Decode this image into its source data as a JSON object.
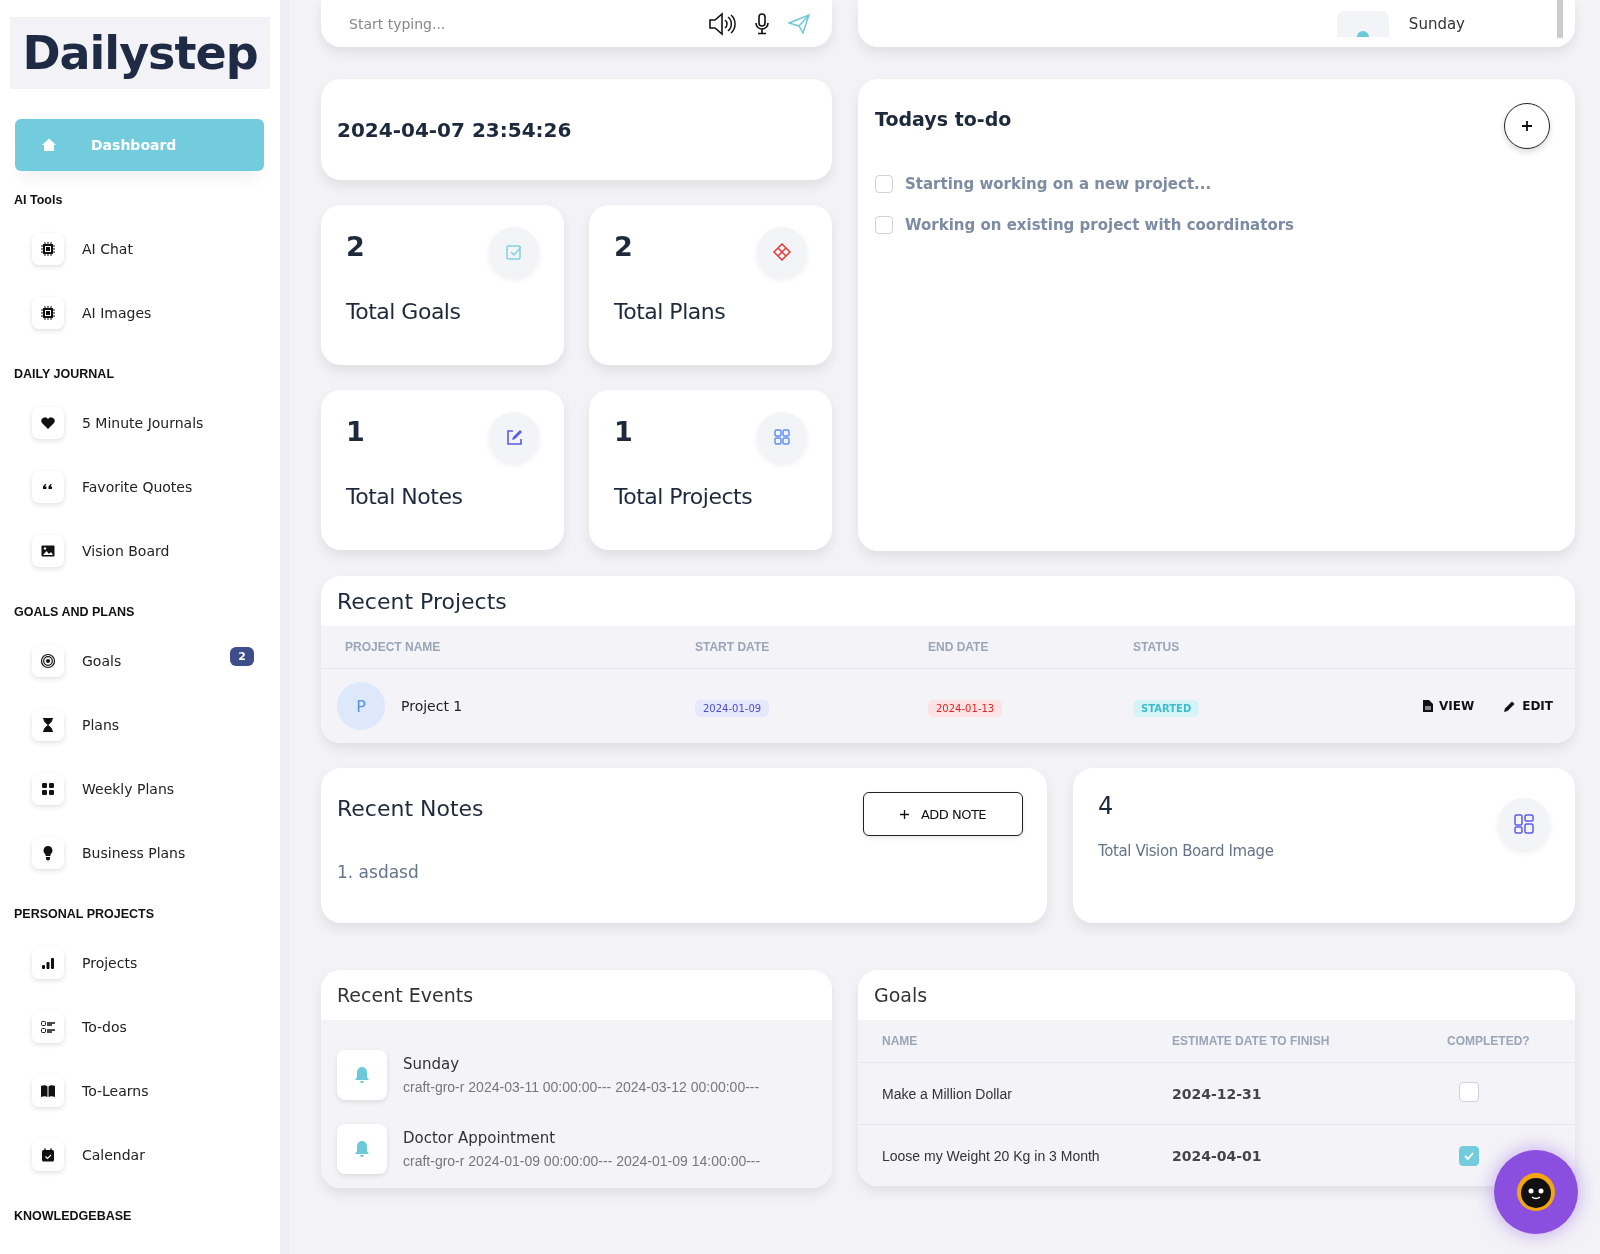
{
  "logo": {
    "text": "Dailystep"
  },
  "sidebar": {
    "dashboard": {
      "label": "Dashboard",
      "selected": true
    },
    "sections": [
      {
        "heading": "AI Tools",
        "items": [
          {
            "label": "AI Chat",
            "selected": false
          },
          {
            "label": "AI Images",
            "selected": false
          }
        ]
      },
      {
        "heading": "DAILY JOURNAL",
        "items": [
          {
            "label": "5 Minute Journals",
            "selected": false
          },
          {
            "label": "Favorite Quotes",
            "selected": false
          },
          {
            "label": "Vision Board",
            "selected": false
          }
        ]
      },
      {
        "heading": "GOALS AND PLANS",
        "items": [
          {
            "label": "Goals",
            "selected": false,
            "badge": "2"
          },
          {
            "label": "Plans",
            "selected": false
          },
          {
            "label": "Weekly Plans",
            "selected": false
          },
          {
            "label": "Business Plans",
            "selected": false
          }
        ]
      },
      {
        "heading": "PERSONAL PROJECTS",
        "items": [
          {
            "label": "Projects",
            "selected": false
          },
          {
            "label": "To-dos",
            "selected": false
          },
          {
            "label": "To-Learns",
            "selected": false
          },
          {
            "label": "Calendar",
            "selected": false
          }
        ]
      },
      {
        "heading": "KNOWLEDGEBASE"
      }
    ]
  },
  "chat": {
    "placeholder": "Start typing..."
  },
  "top_event": {
    "title": "Sunday"
  },
  "datetime": "2024-04-07 23:54:26",
  "stats": [
    {
      "value": "2",
      "label": "Total Goals"
    },
    {
      "value": "2",
      "label": "Total Plans"
    },
    {
      "value": "1",
      "label": "Total Notes"
    },
    {
      "value": "1",
      "label": "Total Projects"
    }
  ],
  "todo": {
    "title": "Todays to-do",
    "items": [
      {
        "text": "Starting working on a new project...",
        "checked": false
      },
      {
        "text": "Working on existing project with coordinators",
        "checked": false
      }
    ]
  },
  "recent_projects": {
    "title": "Recent Projects",
    "columns": [
      "PROJECT NAME",
      "START DATE",
      "END DATE",
      "STATUS"
    ],
    "rows": [
      {
        "avatar": "P",
        "name": "Project 1",
        "start_date": "2024-01-09",
        "end_date": "2024-01-13",
        "status": "STARTED",
        "actions": [
          "VIEW",
          "EDIT"
        ]
      }
    ]
  },
  "recent_notes": {
    "title": "Recent Notes",
    "button": "ADD NOTE",
    "items": [
      "1. asdasd"
    ]
  },
  "vision": {
    "value": "4",
    "label": "Total Vision Board Image"
  },
  "recent_events": {
    "title": "Recent Events",
    "items": [
      {
        "title": "Sunday",
        "detail": "craft-gro-r 2024-03-11 00:00:00--- 2024-03-12 00:00:00---"
      },
      {
        "title": "Doctor Appointment",
        "detail": "craft-gro-r 2024-01-09 00:00:00--- 2024-01-09 14:00:00---"
      }
    ]
  },
  "goals": {
    "title": "Goals",
    "columns": [
      "NAME",
      "ESTIMATE DATE TO FINISH",
      "COMPLETED?"
    ],
    "rows": [
      {
        "name": "Make a Million Dollar",
        "date": "2024-12-31",
        "completed": false
      },
      {
        "name": "Loose my Weight 20 Kg in 3 Month",
        "date": "2024-04-01",
        "completed": true
      }
    ]
  }
}
